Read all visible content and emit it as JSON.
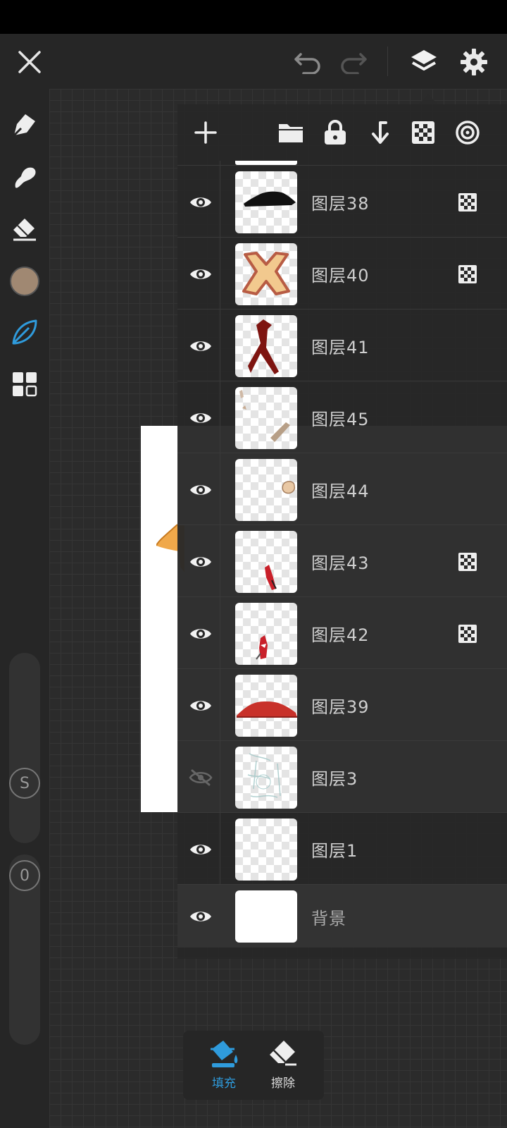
{
  "top_bar": {
    "close_icon": "close-icon",
    "undo_icon": "undo-icon",
    "redo_icon": "redo-icon",
    "layers_icon": "layers-icon",
    "settings_icon": "gear-icon"
  },
  "tools": [
    {
      "name": "pen-tool-icon"
    },
    {
      "name": "smudge-tool-icon"
    },
    {
      "name": "eraser-tool-icon"
    },
    {
      "name": "color-swatch",
      "color": "#a08872"
    },
    {
      "name": "leaf-brush-icon",
      "color": "#2f9bdc"
    },
    {
      "name": "grid-tool-icon"
    }
  ],
  "sliders": {
    "size_label": "S",
    "opacity_label": "0"
  },
  "layers_panel": {
    "toolbar_icons": [
      "add-icon",
      "folder-icon",
      "lock-icon",
      "merge-down-icon",
      "alpha-lock-icon",
      "reference-icon"
    ],
    "layers": [
      {
        "name": "图层38",
        "visible": true,
        "alpha_lock": true,
        "thumb": "black-shape"
      },
      {
        "name": "图层40",
        "visible": true,
        "alpha_lock": true,
        "thumb": "x-mark"
      },
      {
        "name": "图层41",
        "visible": true,
        "alpha_lock": false,
        "thumb": "red-arrow"
      },
      {
        "name": "图层45",
        "visible": true,
        "alpha_lock": false,
        "thumb": "brown-strokes"
      },
      {
        "name": "图层44",
        "visible": true,
        "alpha_lock": false,
        "thumb": "skin-blob"
      },
      {
        "name": "图层43",
        "visible": true,
        "alpha_lock": true,
        "thumb": "red-shard"
      },
      {
        "name": "图层42",
        "visible": true,
        "alpha_lock": true,
        "thumb": "red-shard-2"
      },
      {
        "name": "图层39",
        "visible": true,
        "alpha_lock": false,
        "thumb": "red-hat"
      },
      {
        "name": "图层3",
        "visible": false,
        "alpha_lock": false,
        "thumb": "sketch"
      },
      {
        "name": "图层1",
        "visible": true,
        "alpha_lock": false,
        "thumb": "empty"
      },
      {
        "name": "背景",
        "visible": true,
        "alpha_lock": false,
        "thumb": "white"
      }
    ]
  },
  "bottom_popup": {
    "fill_label": "填充",
    "erase_label": "擦除",
    "active_color": "#2f9bdc"
  }
}
